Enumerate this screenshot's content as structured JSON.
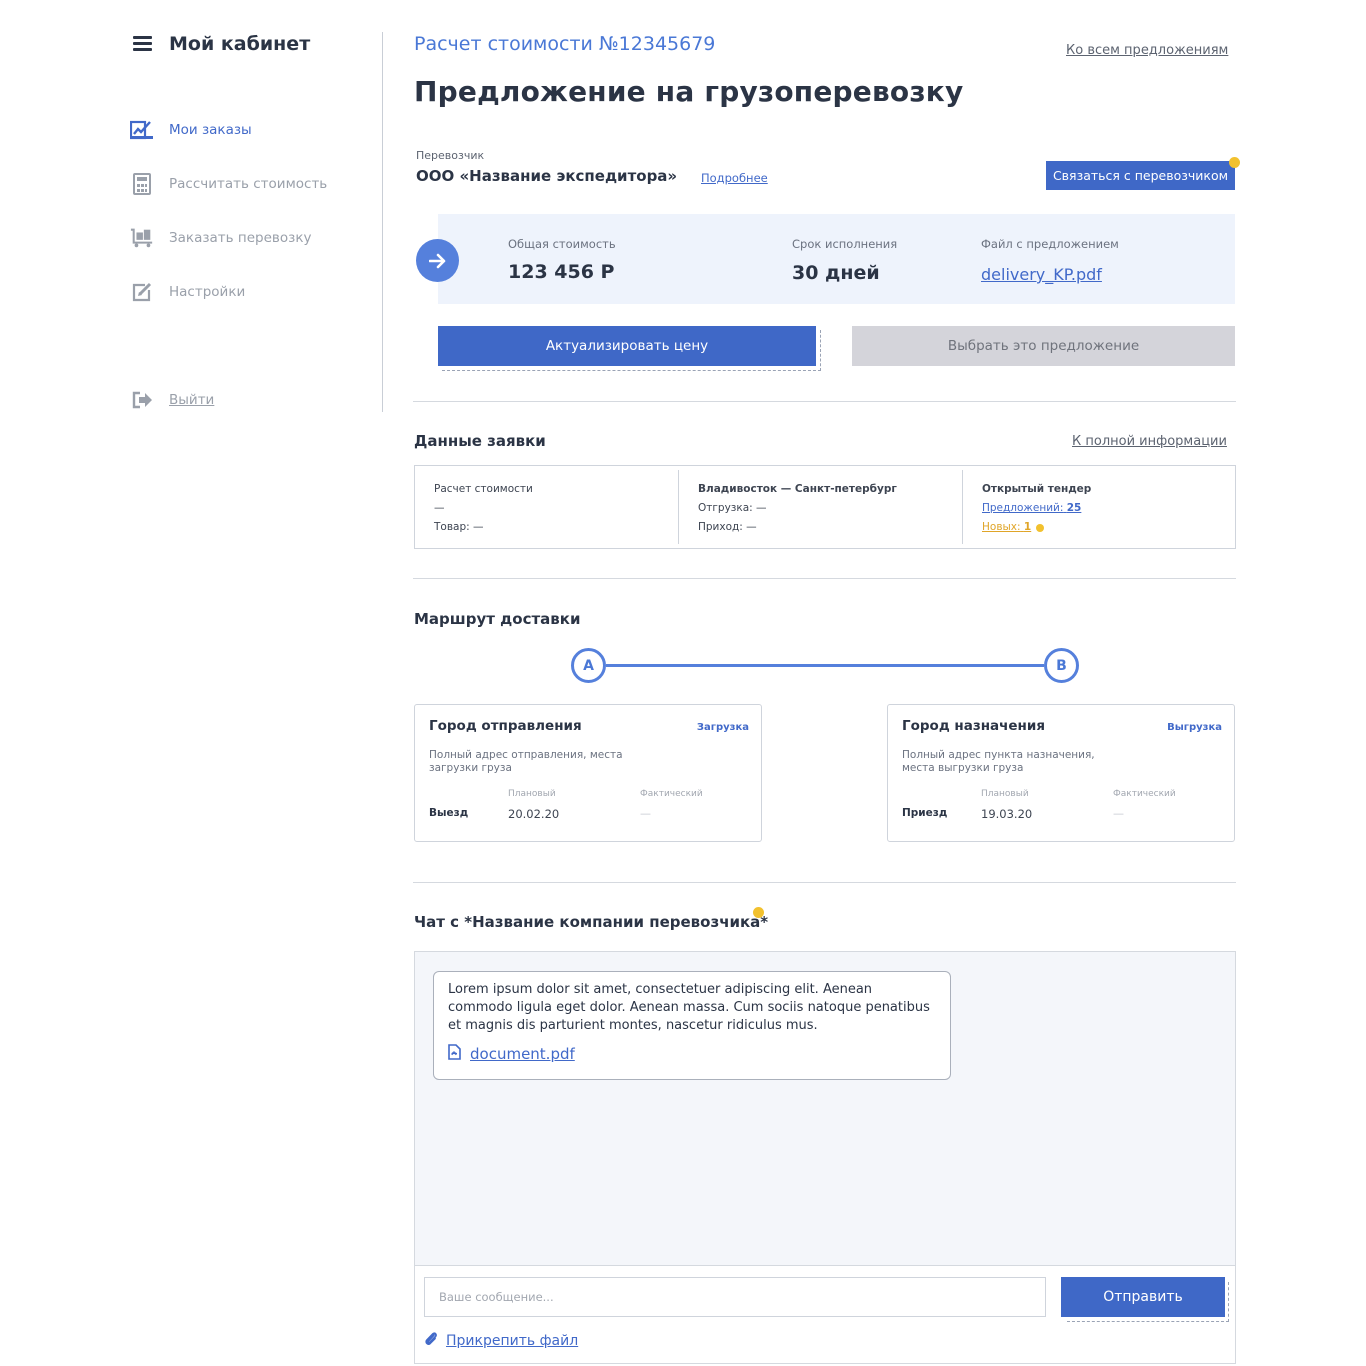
{
  "sidebar": {
    "title": "Мой кабинет",
    "items": [
      {
        "label": "Мои заказы",
        "icon": "orders-edit-icon"
      },
      {
        "label": "Рассчитать стоимость",
        "icon": "calculator-icon"
      },
      {
        "label": "Заказать перевозку",
        "icon": "truck-cart-icon"
      },
      {
        "label": "Настройки",
        "icon": "settings-edit-icon"
      }
    ],
    "logout_label": "Выйти"
  },
  "header": {
    "calc_title": "Расчет стоимости №12345679",
    "all_offers_link": "Ко всем предложениям",
    "page_title": "Предложение на грузоперевозку"
  },
  "carrier": {
    "label": "Перевозчик",
    "name": "ООО «Название экспедитора»",
    "more_link": "Подробнее",
    "contact_button": "Связаться с перевозчиком"
  },
  "summary": {
    "total_label": "Общая стоимость",
    "total_value": "123 456 Р",
    "term_label": "Срок исполнения",
    "term_value": "30 дней",
    "file_label": "Файл с предложением",
    "file_link": "delivery_KP.pdf"
  },
  "actions": {
    "update_price": "Актуализировать цену",
    "choose_offer": "Выбрать это предложение"
  },
  "order": {
    "title": "Данные заявки",
    "full_link": "К полной информации",
    "col1": {
      "l1": "Расчет стоимости",
      "l2": "—",
      "l3": "Товар: —"
    },
    "col2": {
      "l1": "Владивосток — Санкт-петербург",
      "l2": "Отгрузка: —",
      "l3": "Приход: —"
    },
    "col3": {
      "l1": "Открытый тендер",
      "l2_label": "Предложений:",
      "l2_value": "25",
      "l3_label": "Новых:",
      "l3_value": "1"
    }
  },
  "route": {
    "title": "Маршрут доставки",
    "node_a": "A",
    "node_b": "B",
    "from": {
      "title": "Город отправления",
      "tag": "Загрузка",
      "address": "Полный адрес отправления, места загрузки груза",
      "planned_label": "Плановый",
      "actual_label": "Фактический",
      "row_label": "Выезд",
      "planned_value": "20.02.20",
      "actual_value": "—"
    },
    "to": {
      "title": "Город назначения",
      "tag": "Выгрузка",
      "address": "Полный адрес пункта назначения, места выгрузки груза",
      "planned_label": "Плановый",
      "actual_label": "Фактический",
      "row_label": "Приезд",
      "planned_value": "19.03.20",
      "actual_value": "—"
    }
  },
  "chat": {
    "title": "Чат с *Название компании перевозчика*",
    "message": "Lorem ipsum dolor sit amet, consectetuer adipiscing elit. Aenean commodo ligula eget dolor. Aenean massa. Cum sociis natoque penatibus et magnis dis parturient montes, nascetur ridiculus mus.",
    "attachment": "document.pdf",
    "input_placeholder": "Ваше сообщение...",
    "send_button": "Отправить",
    "attach_label": "Прикрепить файл"
  },
  "colors": {
    "accent": "#3f68c7",
    "accent_light": "#5580dc",
    "panel_bg": "#eef3fc",
    "notification": "#f2c12e",
    "muted": "#9aa0aa"
  }
}
